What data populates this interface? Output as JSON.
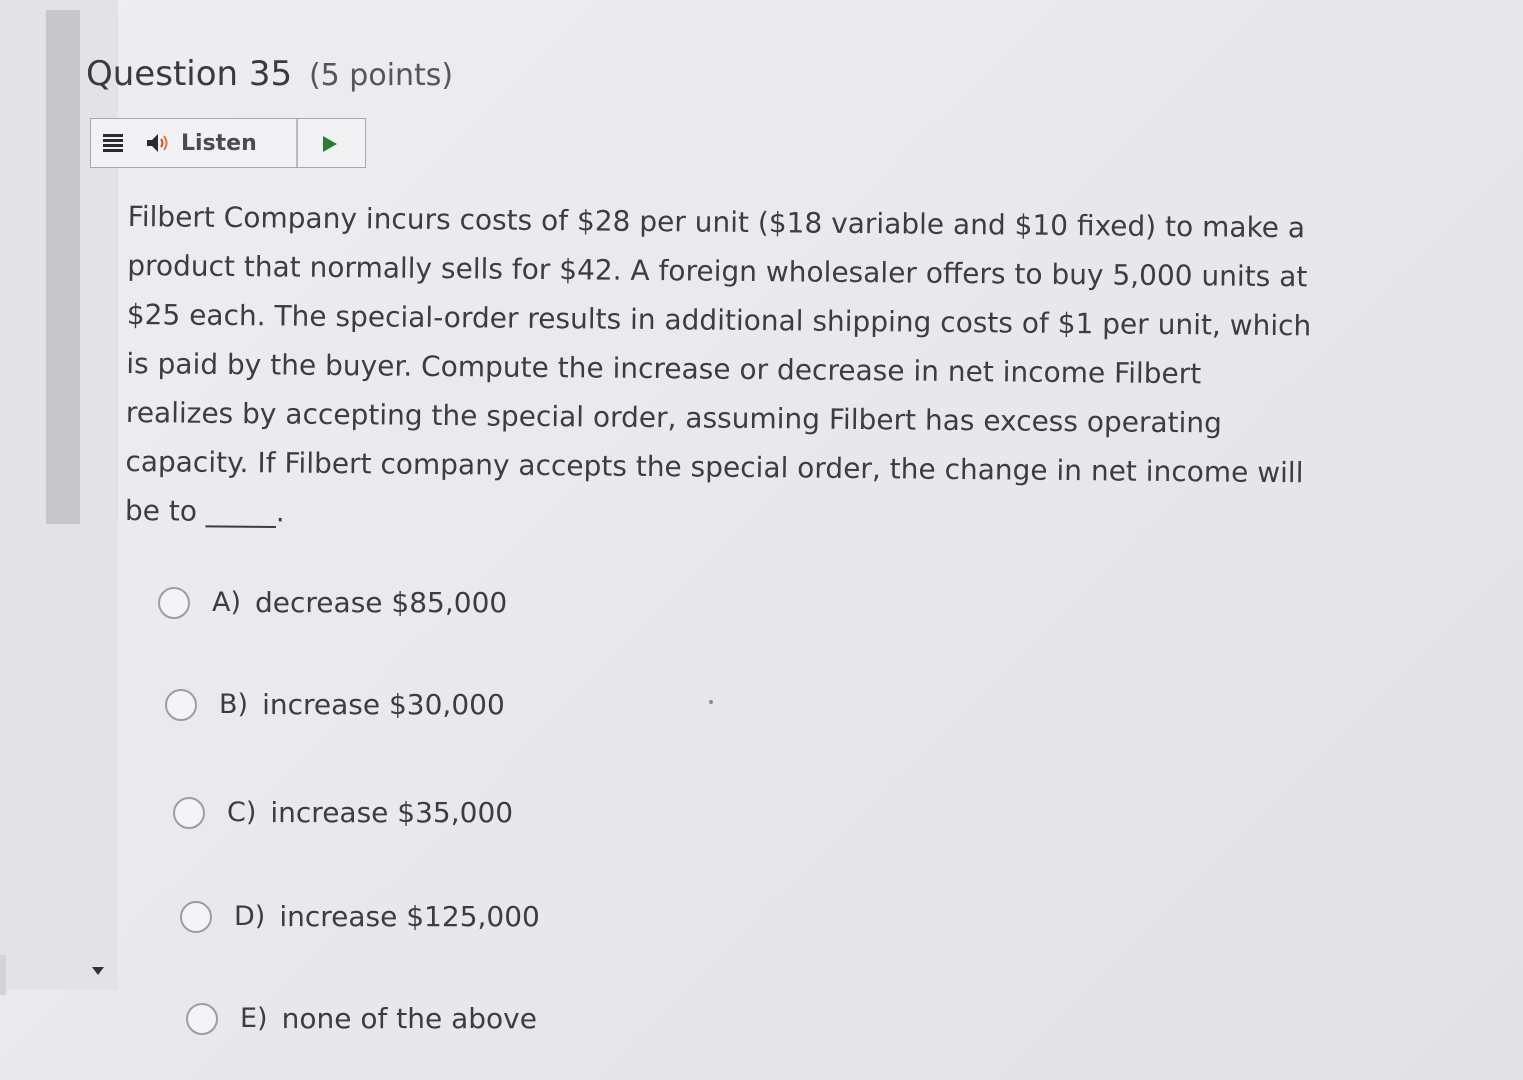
{
  "question": {
    "title": "Question 35",
    "points": "(5 points)"
  },
  "toolbar": {
    "menu_icon": "menu-icon",
    "speaker_icon": "speaker-icon",
    "listen_label": "Listen",
    "play_icon": "play-icon"
  },
  "question_text_lines": [
    "Filbert Company incurs costs of $28 per unit ($18 variable and $10 fixed) to make a",
    "product that normally sells for $42. A foreign wholesaler offers to buy 5,000 units at",
    "$25 each. The special-order results in additional shipping costs of $1 per unit, which",
    "is paid by the buyer.   Compute the increase or decrease in net income Filbert",
    "realizes by accepting the special order, assuming Filbert has excess operating",
    "capacity. If Filbert company accepts the special order, the change in net income will",
    "be to _____."
  ],
  "options": [
    {
      "letter": "A)",
      "text": "decrease $85,000"
    },
    {
      "letter": "B)",
      "text": "increase $30,000"
    },
    {
      "letter": "C)",
      "text": "increase $35,000"
    },
    {
      "letter": "D)",
      "text": "increase $125,000"
    },
    {
      "letter": "E)",
      "text": "none of the above"
    }
  ],
  "colors": {
    "background": "#e9e9ec",
    "text": "#3c3c41",
    "play_button": "#2f7d2f",
    "toolbar_border": "#a7a7ad"
  }
}
